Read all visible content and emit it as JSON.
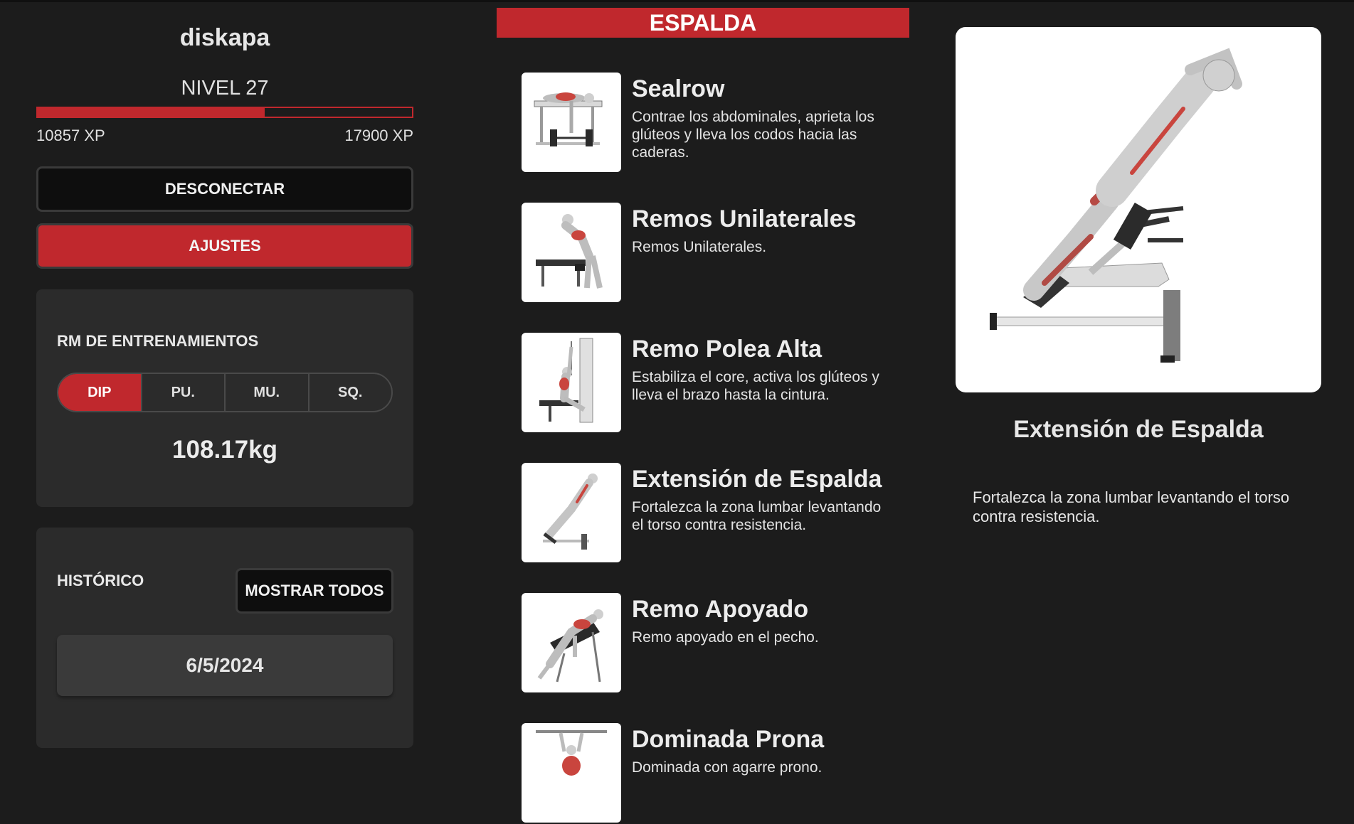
{
  "profile": {
    "username": "diskapa",
    "level_label": "NIVEL 27",
    "xp_current": "10857 XP",
    "xp_next": "17900 XP",
    "xp_progress": 0.607
  },
  "actions": {
    "disconnect_label": "DESCONECTAR",
    "settings_label": "AJUSTES"
  },
  "rm_card": {
    "title": "RM DE ENTRENAMIENTOS",
    "tabs": [
      "DIP",
      "PU.",
      "MU.",
      "SQ."
    ],
    "active_tab": "DIP",
    "value": "108.17kg"
  },
  "history": {
    "title": "HISTÓRICO",
    "show_all_label": "MOSTRAR TODOS",
    "entries": [
      "6/5/2024"
    ]
  },
  "category": {
    "title": "ESPALDA"
  },
  "exercises": [
    {
      "name": "Sealrow",
      "description": "Contrae los abdominales, aprieta los glúteos y lleva los codos hacia las caderas."
    },
    {
      "name": "Remos Unilaterales",
      "description": "Remos Unilaterales."
    },
    {
      "name": "Remo Polea Alta",
      "description": "Estabiliza el core, activa los glúteos y lleva el brazo hasta la cintura."
    },
    {
      "name": "Extensión de Espalda",
      "description": "Fortalezca la zona lumbar levantando el torso contra resistencia."
    },
    {
      "name": "Remo Apoyado",
      "description": "Remo apoyado en el pecho."
    },
    {
      "name": "Dominada Prona",
      "description": "Dominada con agarre prono."
    }
  ],
  "detail": {
    "title": "Extensión de Espalda",
    "description": "Fortalezca la zona lumbar levantando el torso contra resistencia."
  },
  "colors": {
    "accent": "#c0282d",
    "background": "#1c1c1c",
    "card": "#2b2b2b"
  }
}
